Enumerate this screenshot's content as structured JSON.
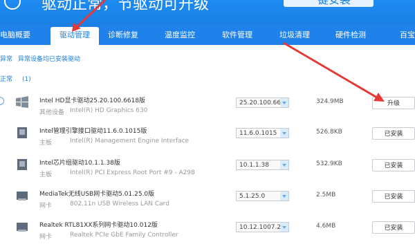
{
  "header": {
    "title": "驱动正常，节驱动可升级",
    "top_button": "一键安装"
  },
  "tabs": [
    {
      "label": "电脑概要"
    },
    {
      "label": "驱动管理"
    },
    {
      "label": "诊断修复"
    },
    {
      "label": "温度监控"
    },
    {
      "label": "软件管理"
    },
    {
      "label": "垃圾清理"
    },
    {
      "label": "硬件检测"
    },
    {
      "label": "百宝"
    }
  ],
  "subnav": {
    "item1": "异常",
    "item2": "异常设备均已安装驱动"
  },
  "section": {
    "label": "正常",
    "count": "(1)"
  },
  "drivers": [
    {
      "name": "Intel HD显卡驱动25.20.100.6618版",
      "type": "其他设备",
      "model": "Intel(R) HD Graphics 630",
      "version": "25.20.100.66",
      "size": "324.9MB",
      "action": "升级"
    },
    {
      "name": "Intel管理引擎接口驱动11.6.0.1015版",
      "type": "主板",
      "model": "Intel(R) Management Engine Interface",
      "version": "11.6.0.1015",
      "size": "526.8KB",
      "action": "已安装"
    },
    {
      "name": "Intel芯片组驱动10.1.1.38版",
      "type": "主板",
      "model": "Intel(R) PCI Express Root Port #9 - A298",
      "version": "10.1.1.38",
      "size": "532.9KB",
      "action": "已安装"
    },
    {
      "name": "MediaTek无线USB网卡驱动5.01.25.0版",
      "type": "网卡",
      "model": "802.11n USB Wireless LAN Card",
      "version": "5.1.25.0",
      "size": "2.5MB",
      "action": "已安装"
    },
    {
      "name": "Realtek RTL81XX系列网卡驱动10.012版",
      "type": "网卡",
      "model": "Realtek PCIe GbE Family Controller",
      "version": "10.12.1007.2",
      "size": "4.6MB",
      "action": "已安装"
    }
  ],
  "colors": {
    "brand": "#1a7fe3",
    "annotation": "#e53935"
  }
}
